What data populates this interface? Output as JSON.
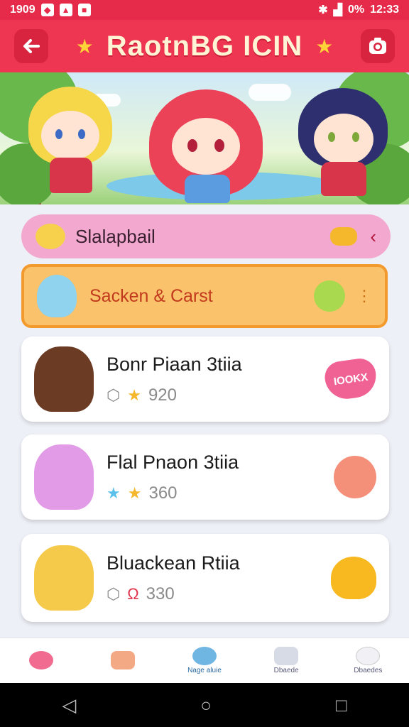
{
  "status": {
    "left_text": "1909",
    "battery": "0%",
    "time": "12:33"
  },
  "appbar": {
    "title": "RaotnBG ICIN"
  },
  "section_pill": {
    "label": "Slalapbail"
  },
  "highlight": {
    "label": "Sacken & Carst"
  },
  "list": [
    {
      "name": "Bonr Piaan 3tiia",
      "score": "920",
      "badge": "IOOKX"
    },
    {
      "name": "Flal Pnaon 3tiia",
      "score": "360"
    },
    {
      "name": "Bluackean Rtiia",
      "score": "330"
    }
  ],
  "bottom_nav": [
    {
      "label": ""
    },
    {
      "label": ""
    },
    {
      "label": "Nage aluie"
    },
    {
      "label": "Dbaede"
    },
    {
      "label": "Dbaedes"
    }
  ],
  "colors": {
    "accent": "#ee3551",
    "pill": "#f3a9cf",
    "highlight": "#f9c26b"
  }
}
